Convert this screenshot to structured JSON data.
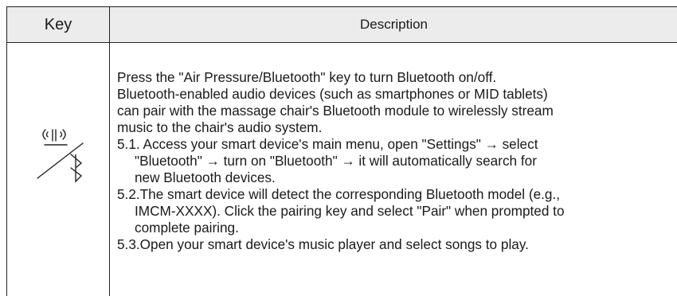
{
  "header": {
    "key_label": "Key",
    "description_label": "Description"
  },
  "row": {
    "icon": "air-pressure-bluetooth-icon",
    "description_lines": [
      "Press the \"Air Pressure/Bluetooth\" key to turn Bluetooth on/off.",
      "Bluetooth-enabled audio devices (such as smartphones or MID tablets)",
      "can pair with the massage chair's Bluetooth module to wirelessly stream",
      "music to the chair's audio system.",
      "5.1. Access your smart device's main menu, open \"Settings\" → select",
      "\"Bluetooth\" → turn on \"Bluetooth\" → it will automatically search for",
      "new Bluetooth devices.",
      "5.2.The smart device will detect the corresponding Bluetooth model (e.g.,",
      "IMCM-XXXX). Click the pairing key and select \"Pair\" when prompted to",
      "complete pairing.",
      "5.3.Open your smart device's music player and select songs to play."
    ]
  }
}
